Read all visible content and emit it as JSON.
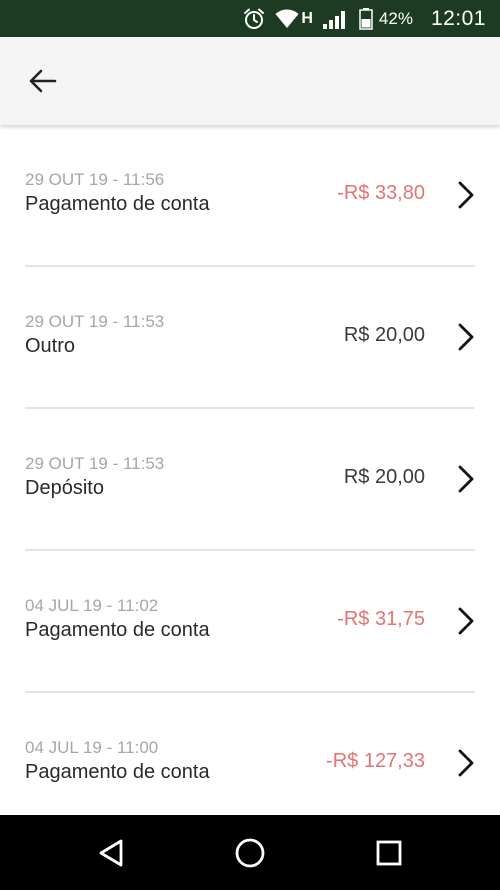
{
  "status_bar": {
    "network_type": "H",
    "battery_percent": "42%",
    "time": "12:01",
    "icons": [
      "alarm-icon",
      "wifi-icon",
      "signal-icon",
      "battery-icon"
    ]
  },
  "app_bar": {
    "back_icon": "arrow-left-icon"
  },
  "transactions": [
    {
      "date": "29 OUT 19 - 11:56",
      "description": "Pagamento de conta",
      "amount": "-R$ 33,80",
      "type": "negative"
    },
    {
      "date": "29 OUT 19 - 11:53",
      "description": "Outro",
      "amount": "R$ 20,00",
      "type": "positive"
    },
    {
      "date": "29 OUT 19 - 11:53",
      "description": "Depósito",
      "amount": "R$ 20,00",
      "type": "positive"
    },
    {
      "date": "04 JUL 19 - 11:02",
      "description": "Pagamento de conta",
      "amount": "-R$ 31,75",
      "type": "negative"
    },
    {
      "date": "04 JUL 19 - 11:00",
      "description": "Pagamento de conta",
      "amount": "-R$ 127,33",
      "type": "negative"
    }
  ],
  "colors": {
    "status_bar_bg": "#1d3b22",
    "app_bar_bg": "#f5f5f5",
    "negative_amount": "#e57373",
    "positive_amount": "#3a3a3a",
    "date_text": "#a6a6a6",
    "divider": "#e3e3e3",
    "nav_bar_bg": "#000000"
  },
  "nav_bar": {
    "buttons": [
      "back-triangle-icon",
      "home-circle-icon",
      "recents-square-icon"
    ]
  }
}
